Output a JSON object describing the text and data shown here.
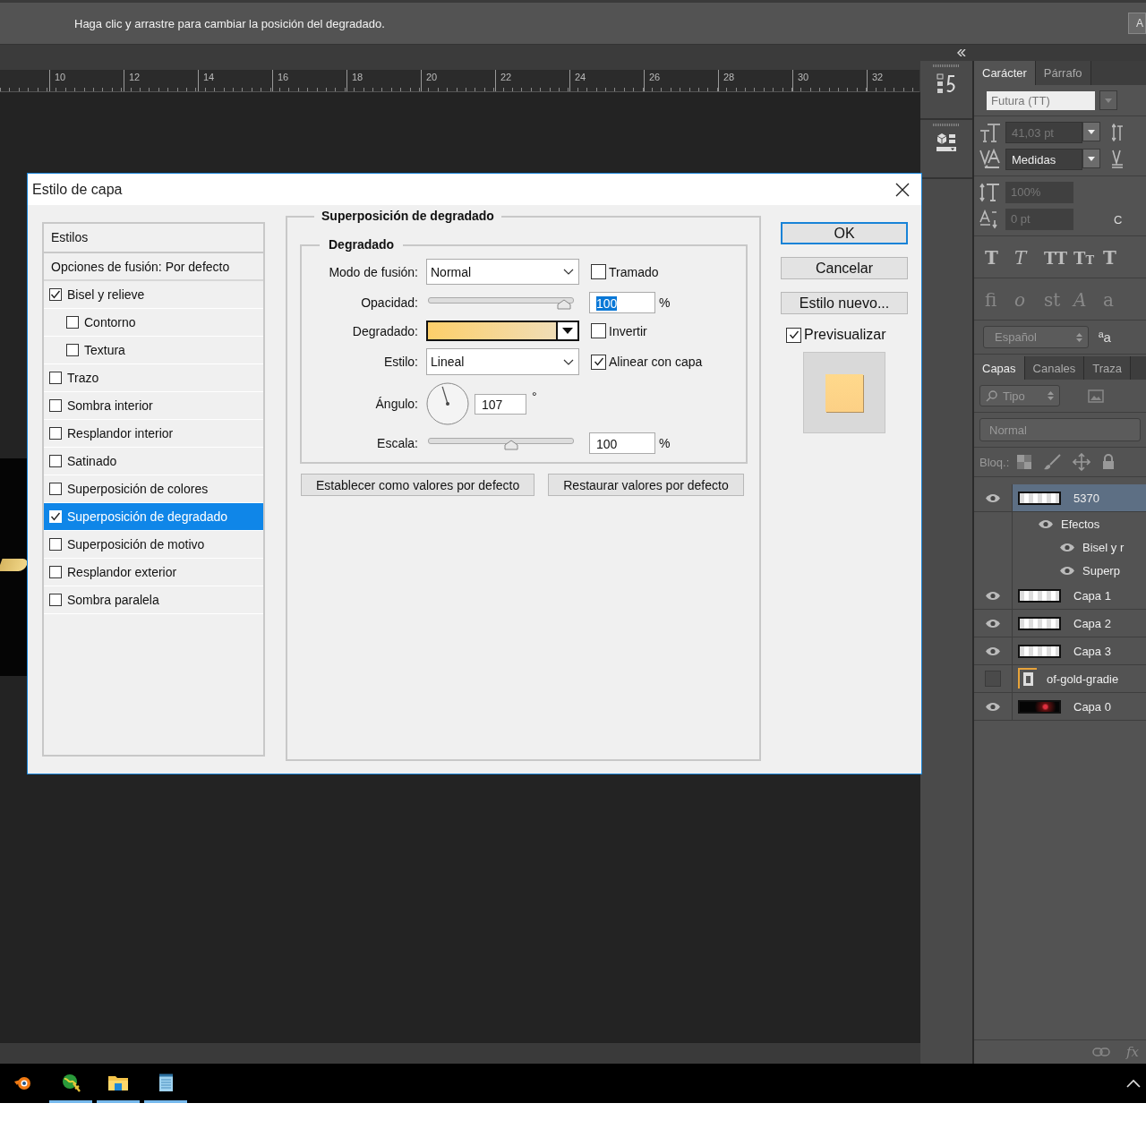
{
  "options_bar": {
    "hint": "Haga clic y arrastre para cambiar la posición del degradado.",
    "button": "A"
  },
  "ruler": {
    "labels": [
      "10",
      "12",
      "14",
      "16",
      "18",
      "20",
      "22",
      "24",
      "26",
      "28",
      "30",
      "32"
    ]
  },
  "dialog": {
    "title": "Estilo de capa",
    "styles_header": "Estilos",
    "styles": [
      {
        "label": "Opciones de fusión: Por defecto",
        "kind": "header",
        "selected": false
      },
      {
        "label": "Bisel y relieve",
        "kind": "effect",
        "checked": true,
        "selected": false,
        "children": [
          {
            "label": "Contorno",
            "kind": "effect",
            "checked": false,
            "selected": false
          },
          {
            "label": "Textura",
            "kind": "effect",
            "checked": false,
            "selected": false
          }
        ]
      },
      {
        "label": "Trazo",
        "kind": "effect",
        "checked": false,
        "selected": false
      },
      {
        "label": "Sombra interior",
        "kind": "effect",
        "checked": false,
        "selected": false
      },
      {
        "label": "Resplandor interior",
        "kind": "effect",
        "checked": false,
        "selected": false
      },
      {
        "label": "Satinado",
        "kind": "effect",
        "checked": false,
        "selected": false
      },
      {
        "label": "Superposición de colores",
        "kind": "effect",
        "checked": false,
        "selected": false
      },
      {
        "label": "Superposición de degradado",
        "kind": "effect",
        "checked": true,
        "selected": true
      },
      {
        "label": "Superposición de motivo",
        "kind": "effect",
        "checked": false,
        "selected": false
      },
      {
        "label": "Resplandor exterior",
        "kind": "effect",
        "checked": false,
        "selected": false
      },
      {
        "label": "Sombra paralela",
        "kind": "effect",
        "checked": false,
        "selected": false
      }
    ],
    "section_title": "Superposición de degradado",
    "group_title": "Degradado",
    "blend_mode": {
      "label": "Modo de fusión:",
      "value": "Normal"
    },
    "dither": {
      "label": "Tramado",
      "checked": false
    },
    "opacity": {
      "label": "Opacidad:",
      "level": 1,
      "value": "100",
      "unit": "%"
    },
    "gradient": {
      "label": "Degradado:"
    },
    "reverse": {
      "label": "Invertir",
      "checked": false
    },
    "style": {
      "label": "Estilo:",
      "value": "Lineal"
    },
    "align": {
      "label": "Alinear con capa",
      "checked": true
    },
    "angle": {
      "label": "Ángulo:",
      "value": "107",
      "unit": "°"
    },
    "scale": {
      "label": "Escala:",
      "level": 0.61,
      "value": "100",
      "unit": "%"
    },
    "default_buttons": [
      "Establecer como valores por defecto",
      "Restaurar valores por defecto"
    ],
    "buttons": [
      {
        "label": "OK",
        "kind": "default"
      },
      {
        "label": "Cancelar",
        "kind": "normal"
      },
      {
        "label": "Estilo nuevo...",
        "kind": "normal"
      }
    ],
    "preview": {
      "label": "Previsualizar",
      "checked": true
    }
  },
  "character_panel": {
    "tabs": [
      {
        "label": "Carácter",
        "selected": true
      },
      {
        "label": "Párrafo",
        "selected": false
      }
    ],
    "font": "Futura (TT)",
    "size": "41,03 pt",
    "kerning": "Medidas",
    "scale": "100%",
    "baseline": "0 pt",
    "color_label": "C",
    "type_styles": [
      {
        "label": "T",
        "kind": "bold"
      },
      {
        "label": "T",
        "kind": "italic"
      },
      {
        "label": "TT",
        "kind": "caps"
      },
      {
        "label": "TT",
        "kind": "smallcaps"
      },
      {
        "label": "T",
        "kind": "bold"
      }
    ],
    "opentype": [
      {
        "label": "fi",
        "kind": "plain"
      },
      {
        "label": "o",
        "kind": "italic"
      },
      {
        "label": "st",
        "kind": "plain"
      },
      {
        "label": "A",
        "kind": "italic"
      },
      {
        "label": "a",
        "kind": "plain"
      }
    ],
    "language": "Español",
    "case_toggle": "ªa"
  },
  "layers_panel": {
    "tabs": [
      {
        "label": "Capas",
        "selected": true
      },
      {
        "label": "Canales",
        "selected": false
      },
      {
        "label": "Traza",
        "selected": false
      }
    ],
    "filter": "Tipo",
    "blend": "Normal",
    "lock_label": "Bloq.:",
    "layers": [
      {
        "name": "5370",
        "visible": true,
        "selected": true,
        "kind": "strip",
        "children": [
          {
            "name": "Efectos",
            "visible": true,
            "children": [
              {
                "name": "Bisel y r",
                "visible": true
              },
              {
                "name": "Superp",
                "visible": true
              }
            ]
          }
        ]
      },
      {
        "name": "Capa 1",
        "visible": true,
        "selected": false,
        "kind": "strip"
      },
      {
        "name": "Capa 2",
        "visible": true,
        "selected": false,
        "kind": "strip"
      },
      {
        "name": "Capa 3",
        "visible": true,
        "selected": false,
        "kind": "strip"
      },
      {
        "name": "of-gold-gradie",
        "visible": false,
        "selected": false,
        "kind": "smart"
      },
      {
        "name": "Capa 0",
        "visible": true,
        "selected": false,
        "kind": "dark"
      }
    ],
    "fx": "fx"
  },
  "taskbar": {
    "apps": [
      {
        "kind": "flame",
        "running": false
      },
      {
        "kind": "globe",
        "running": true
      },
      {
        "kind": "folder",
        "running": true
      },
      {
        "kind": "notepad",
        "running": true
      }
    ]
  }
}
